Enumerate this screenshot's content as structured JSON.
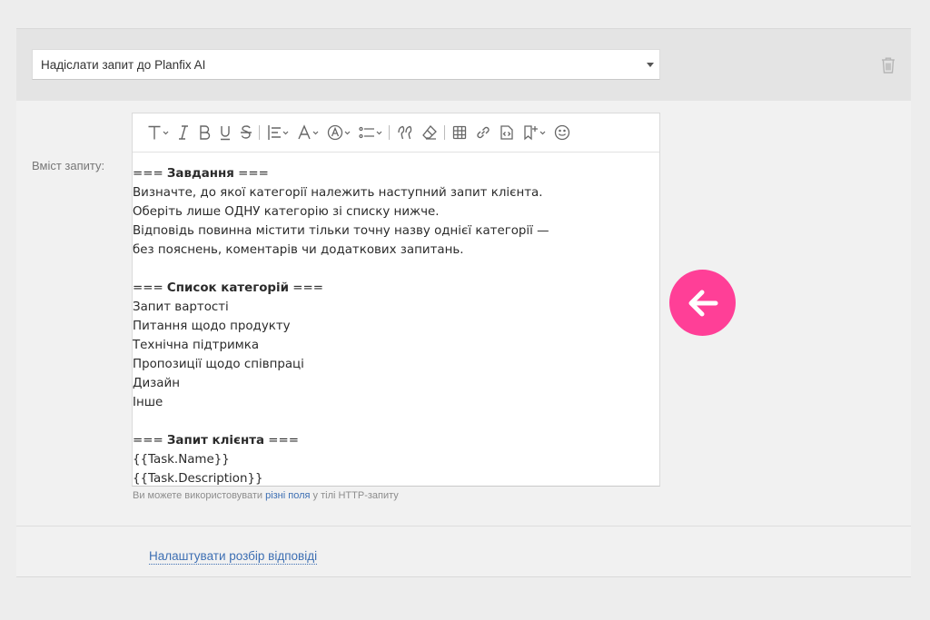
{
  "action_select": {
    "value": "Надіслати запит до Planfix AI"
  },
  "field": {
    "label": "Вміст запиту:"
  },
  "toolbar": {
    "icons": [
      "text-format-icon",
      "italic-icon",
      "bold-icon",
      "underline-icon",
      "strikethrough-icon",
      "align-icon",
      "font-color-icon",
      "highlight-icon",
      "list-icon",
      "quote-icon",
      "clear-format-icon",
      "table-icon",
      "link-icon",
      "code-icon",
      "bookmark-icon",
      "emoji-icon"
    ]
  },
  "content": {
    "task_prefix": "=== ",
    "task_heading": "Завдання",
    "task_suffix": " ===",
    "task_lines": [
      "Визначте, до якої категорії належить наступний запит клієнта.",
      "Оберіть лише ОДНУ категорію зі списку нижче.",
      "Відповідь повинна містити тільки точну назву однієї категорії —",
      "без пояснень, коментарів чи додаткових запитань."
    ],
    "cat_prefix": "=== ",
    "cat_heading": "Список категорій",
    "cat_suffix": " ===",
    "categories": [
      "Запит вартості",
      "Питання щодо продукту",
      "Технічна підтримка",
      "Пропозиції щодо співпраці",
      "Дизайн",
      "Інше"
    ],
    "req_prefix": "=== ",
    "req_heading": "Запит клієнта",
    "req_suffix": " ===",
    "req_lines": [
      "{{Task.Name}}",
      "{{Task.Description}}"
    ]
  },
  "hint": {
    "before": "Ви можете використовувати ",
    "link": "різні поля",
    "after": " у тілі HTTP-запиту"
  },
  "parse_link": "Налаштувати розбір відповіді",
  "colors": {
    "accent": "#ff3f97",
    "link": "#3d6fb3"
  }
}
